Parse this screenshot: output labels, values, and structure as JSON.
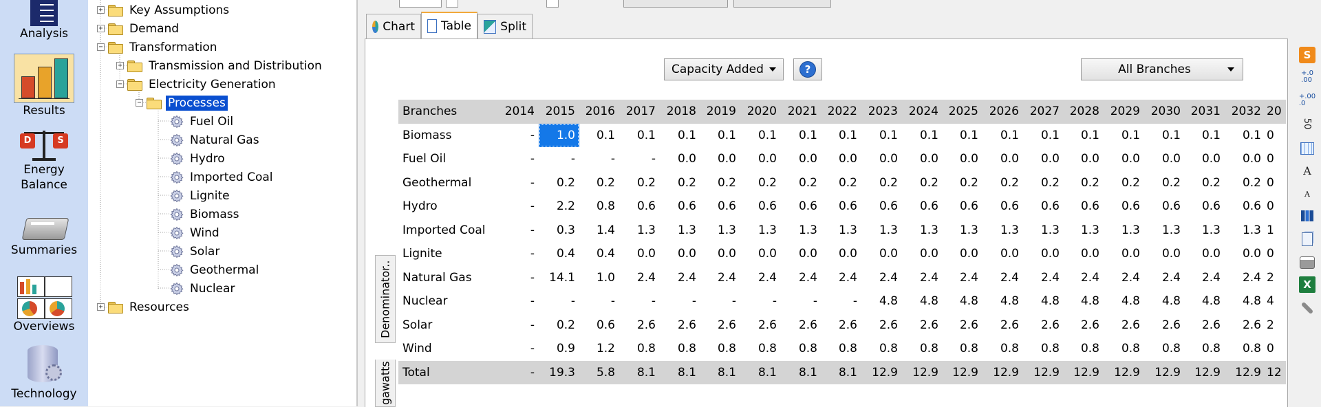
{
  "nav": {
    "items": [
      {
        "label": "Analysis"
      },
      {
        "label": "Results"
      },
      {
        "label": "Energy\nBalance",
        "line1": "Energy",
        "line2": "Balance",
        "badge_left": "D",
        "badge_right": "S"
      },
      {
        "label": "Summaries"
      },
      {
        "label": "Overviews"
      },
      {
        "label": "Technology",
        "line1": "Technology"
      }
    ]
  },
  "tree": {
    "nodes": [
      {
        "label": "Key Assumptions",
        "expander": "+"
      },
      {
        "label": "Demand",
        "expander": "+"
      },
      {
        "label": "Transformation",
        "expander": "−"
      },
      {
        "label": "Transmission and Distribution",
        "expander": "+"
      },
      {
        "label": "Electricity Generation",
        "expander": "−"
      },
      {
        "label": "Processes",
        "expander": "−"
      },
      {
        "label": "Fuel Oil"
      },
      {
        "label": "Natural Gas"
      },
      {
        "label": "Hydro"
      },
      {
        "label": "Imported Coal"
      },
      {
        "label": "Lignite"
      },
      {
        "label": "Biomass"
      },
      {
        "label": "Wind"
      },
      {
        "label": "Solar"
      },
      {
        "label": "Geothermal"
      },
      {
        "label": "Nuclear"
      },
      {
        "label": "Resources",
        "expander": "+"
      }
    ]
  },
  "tabs": [
    {
      "label": "Chart"
    },
    {
      "label": "Table"
    },
    {
      "label": "Split"
    }
  ],
  "panel": {
    "variable_dropdown": "Capacity Added",
    "help_label": "?",
    "branch_dropdown": "All Branches",
    "vtab_denominator": "Denominator..",
    "vtab_units": "gawatts"
  },
  "table": {
    "header_branch": "Branches",
    "years": [
      "2014",
      "2015",
      "2016",
      "2017",
      "2018",
      "2019",
      "2020",
      "2021",
      "2022",
      "2023",
      "2024",
      "2025",
      "2026",
      "2027",
      "2028",
      "2029",
      "2030",
      "2031",
      "2032",
      "20"
    ],
    "rows": [
      {
        "name": "Biomass",
        "values": [
          "-",
          "1.0",
          "0.1",
          "0.1",
          "0.1",
          "0.1",
          "0.1",
          "0.1",
          "0.1",
          "0.1",
          "0.1",
          "0.1",
          "0.1",
          "0.1",
          "0.1",
          "0.1",
          "0.1",
          "0.1",
          "0.1",
          "0"
        ]
      },
      {
        "name": "Fuel Oil",
        "values": [
          "-",
          "-",
          "-",
          "-",
          "0.0",
          "0.0",
          "0.0",
          "0.0",
          "0.0",
          "0.0",
          "0.0",
          "0.0",
          "0.0",
          "0.0",
          "0.0",
          "0.0",
          "0.0",
          "0.0",
          "0.0",
          "0"
        ]
      },
      {
        "name": "Geothermal",
        "values": [
          "-",
          "0.2",
          "0.2",
          "0.2",
          "0.2",
          "0.2",
          "0.2",
          "0.2",
          "0.2",
          "0.2",
          "0.2",
          "0.2",
          "0.2",
          "0.2",
          "0.2",
          "0.2",
          "0.2",
          "0.2",
          "0.2",
          "0"
        ]
      },
      {
        "name": "Hydro",
        "values": [
          "-",
          "2.2",
          "0.8",
          "0.6",
          "0.6",
          "0.6",
          "0.6",
          "0.6",
          "0.6",
          "0.6",
          "0.6",
          "0.6",
          "0.6",
          "0.6",
          "0.6",
          "0.6",
          "0.6",
          "0.6",
          "0.6",
          "0"
        ]
      },
      {
        "name": "Imported Coal",
        "values": [
          "-",
          "0.3",
          "1.4",
          "1.3",
          "1.3",
          "1.3",
          "1.3",
          "1.3",
          "1.3",
          "1.3",
          "1.3",
          "1.3",
          "1.3",
          "1.3",
          "1.3",
          "1.3",
          "1.3",
          "1.3",
          "1.3",
          "1"
        ]
      },
      {
        "name": "Lignite",
        "values": [
          "-",
          "0.4",
          "0.4",
          "0.0",
          "0.0",
          "0.0",
          "0.0",
          "0.0",
          "0.0",
          "0.0",
          "0.0",
          "0.0",
          "0.0",
          "0.0",
          "0.0",
          "0.0",
          "0.0",
          "0.0",
          "0.0",
          "0"
        ]
      },
      {
        "name": "Natural Gas",
        "values": [
          "-",
          "14.1",
          "1.0",
          "2.4",
          "2.4",
          "2.4",
          "2.4",
          "2.4",
          "2.4",
          "2.4",
          "2.4",
          "2.4",
          "2.4",
          "2.4",
          "2.4",
          "2.4",
          "2.4",
          "2.4",
          "2.4",
          "2"
        ]
      },
      {
        "name": "Nuclear",
        "values": [
          "-",
          "-",
          "-",
          "-",
          "-",
          "-",
          "-",
          "-",
          "-",
          "4.8",
          "4.8",
          "4.8",
          "4.8",
          "4.8",
          "4.8",
          "4.8",
          "4.8",
          "4.8",
          "4.8",
          "4"
        ]
      },
      {
        "name": "Solar",
        "values": [
          "-",
          "0.2",
          "0.6",
          "2.6",
          "2.6",
          "2.6",
          "2.6",
          "2.6",
          "2.6",
          "2.6",
          "2.6",
          "2.6",
          "2.6",
          "2.6",
          "2.6",
          "2.6",
          "2.6",
          "2.6",
          "2.6",
          "2"
        ]
      },
      {
        "name": "Wind",
        "values": [
          "-",
          "0.9",
          "1.2",
          "0.8",
          "0.8",
          "0.8",
          "0.8",
          "0.8",
          "0.8",
          "0.8",
          "0.8",
          "0.8",
          "0.8",
          "0.8",
          "0.8",
          "0.8",
          "0.8",
          "0.8",
          "0.8",
          "0"
        ]
      }
    ],
    "total": {
      "name": "Total",
      "values": [
        "-",
        "19.3",
        "5.8",
        "8.1",
        "8.1",
        "8.1",
        "8.1",
        "8.1",
        "8.1",
        "12.9",
        "12.9",
        "12.9",
        "12.9",
        "12.9",
        "12.9",
        "12.9",
        "12.9",
        "12.9",
        "12.9",
        "12"
      ]
    }
  },
  "toolbar": {
    "icons": [
      "s-badge-icon",
      "increase-decimals-icon",
      "decrease-decimals-icon",
      "units-icon",
      "grid-icon",
      "font-larger-icon",
      "font-smaller-icon",
      "chart-export-icon",
      "copy-icon",
      "print-icon",
      "excel-icon",
      "settings-icon"
    ],
    "s_badge": "S",
    "inc_dec_text": "+.0\n.00",
    "dec_dec_text": "+.00\n.0",
    "units_text": "50",
    "font_large": "A",
    "font_small": "A",
    "excel_text": "X"
  },
  "colors": {
    "accent_tab": "#f2a93b",
    "selection": "#1478e8",
    "nav_bg": "#ccdcf5"
  }
}
